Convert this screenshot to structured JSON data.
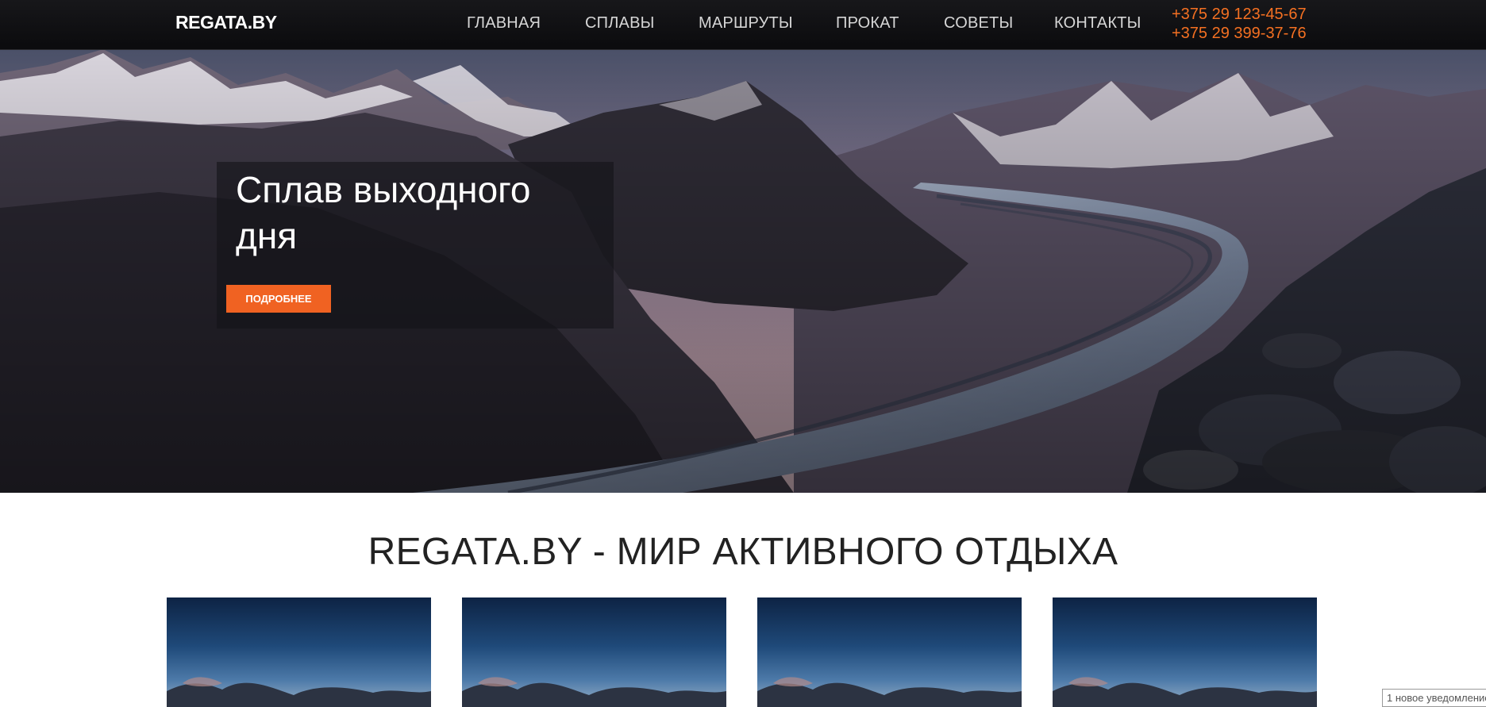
{
  "header": {
    "logo": "REGATA.BY",
    "nav": [
      {
        "label": "ГЛАВНАЯ"
      },
      {
        "label": "СПЛАВЫ"
      },
      {
        "label": "МАРШРУТЫ"
      },
      {
        "label": "ПРОКАТ"
      },
      {
        "label": "СОВЕТЫ"
      },
      {
        "label": "КОНТАКТЫ"
      }
    ],
    "phones": [
      "+375 29 123-45-67",
      "+375 29 399-37-76"
    ]
  },
  "hero": {
    "title": "Сплав выходного дня",
    "button_label": "ПОДРОБНЕЕ"
  },
  "section": {
    "title": "REGATA.BY - МИР АКТИВНОГО ОТДЫХА"
  },
  "notification": "1 новое уведомление",
  "colors": {
    "accent": "#f06222",
    "header_bg": "#0f0f12",
    "phone_text": "#f47022"
  }
}
